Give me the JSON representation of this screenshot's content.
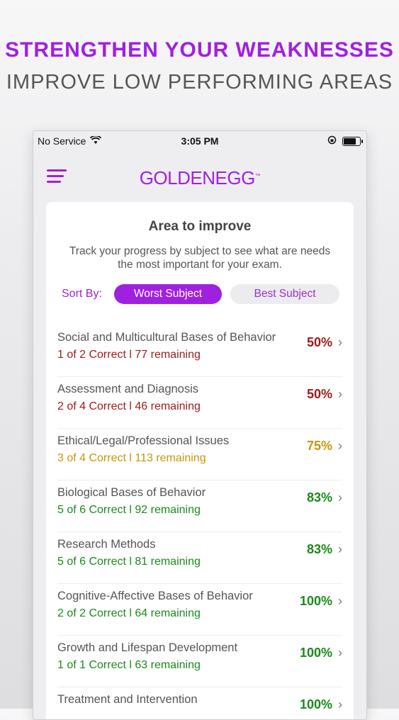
{
  "promo": {
    "line1": "STRENGTHEN YOUR WEAKNESSES",
    "line2": "IMPROVE LOW PERFORMING AREAS"
  },
  "status": {
    "carrier": "No Service",
    "time": "3:05 PM"
  },
  "app": {
    "logo": "GOLDENEGG",
    "tm": "™"
  },
  "card": {
    "title": "Area to improve",
    "description": "Track your progress by subject to see what are needs the most important for your exam.",
    "sort_label": "Sort By:",
    "sort_options": [
      "Worst Subject",
      "Best Subject"
    ]
  },
  "colors": {
    "accent": "#a020e0",
    "red": "#9b1b1b",
    "amber": "#c9950a",
    "green": "#1a8a1a"
  },
  "subjects": [
    {
      "name": "Social and Multicultural Bases of Behavior",
      "stat": "1 of 2  Correct l 77 remaining",
      "pct": "50%",
      "color": "#9b1b1b"
    },
    {
      "name": "Assessment and Diagnosis",
      "stat": "2 of 4  Correct l 46 remaining",
      "pct": "50%",
      "color": "#9b1b1b"
    },
    {
      "name": "Ethical/Legal/Professional Issues",
      "stat": "3 of 4  Correct l 113 remaining",
      "pct": "75%",
      "color": "#c9950a"
    },
    {
      "name": "Biological Bases of Behavior",
      "stat": "5 of 6  Correct l 92 remaining",
      "pct": "83%",
      "color": "#1a8a1a"
    },
    {
      "name": "Research Methods",
      "stat": "5 of 6  Correct l 81 remaining",
      "pct": "83%",
      "color": "#1a8a1a"
    },
    {
      "name": "Cognitive-Affective Bases of Behavior",
      "stat": "2 of 2  Correct l 64 remaining",
      "pct": "100%",
      "color": "#1a8a1a"
    },
    {
      "name": "Growth and Lifespan Development",
      "stat": "1 of 1  Correct l 63 remaining",
      "pct": "100%",
      "color": "#1a8a1a"
    },
    {
      "name": "Treatment and Intervention",
      "stat": "",
      "pct": "100%",
      "color": "#1a8a1a"
    }
  ]
}
